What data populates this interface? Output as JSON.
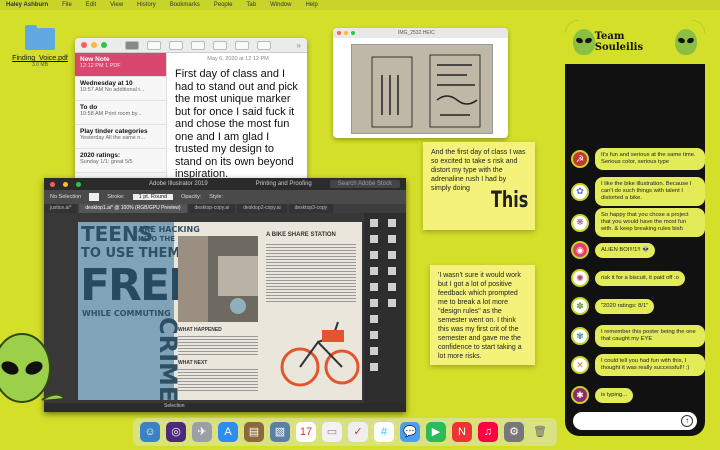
{
  "menubar": {
    "app": "Haley Ashburn",
    "items": [
      "File",
      "Edit",
      "View",
      "History",
      "Bookmarks",
      "People",
      "Tab",
      "Window",
      "Help"
    ]
  },
  "desktop": {
    "file_name": "Finding_Voice.pdf",
    "file_sub": "3.0 MB"
  },
  "notes": {
    "list": [
      {
        "title": "New Note",
        "time": "12:12 PM",
        "preview": "1 PDF"
      },
      {
        "title": "Wednesday at 10",
        "time": "10:57 AM",
        "preview": "No additional t..."
      },
      {
        "title": "To do",
        "time": "10:58 AM",
        "preview": "Print room by..."
      },
      {
        "title": "Play tinder categories",
        "time": "Yesterday",
        "preview": "All the same n..."
      },
      {
        "title": "2020 ratings:",
        "time": "Sunday",
        "preview": "1/1: great 5/5"
      }
    ],
    "date": "May 6, 2020 at 12:12 PM",
    "text": "First day of class and I had to stand out and pick the most unique marker but for once I said fuck it and chose the most fun one and I am glad I trusted my design to stand on its own beyond inspiration."
  },
  "preview": {
    "title": "IMG_2532.HEIC"
  },
  "illustrator": {
    "app_title": "Adobe Illustrator 2019",
    "workspace": "Printing and Proofing",
    "search_placeholder": "Search Adobe Stock",
    "selection_label": "No Selection",
    "stroke_label": "Stroke:",
    "stroke_value": "1 pt. Round",
    "opacity_label": "Opacity:",
    "style_label": "Style:",
    "tabs": [
      "justice.ai*",
      "desktop1.ai* @ 100% (RGB/GPU Preview)",
      "desktop-copy.ai",
      "desktop2-copy.ai",
      "desktop3-copy"
    ],
    "status": "Selection",
    "poster": {
      "teens": "TEENS",
      "hacking": "ARE HACKING",
      "into": "INTO THE BIKES",
      "use": "TO USE THEM FOR",
      "free": "FREE",
      "commuting": "WHILE COMMUTING",
      "crimes": "CRIMES",
      "heading1": "A BIKE SHARE STATION",
      "heading2": "WHAT HAPPENED",
      "heading3": "WHAT NEXT"
    }
  },
  "sticky1": {
    "text": "And the first day of class I was so excited to take s risk and distort my type with the adrenaline rush I had by simply doing",
    "big": "This"
  },
  "sticky2": {
    "text": "'I wasn't sure it would work but I got a lot of positive feedback which prompted me to break a lot more \"design rules\" as the semester went on. I think this was my first crit of the semester and gave me the confidence to start taking a lot more risks."
  },
  "messages": {
    "title": "Team Souleilis",
    "items": [
      {
        "text": "It's fun and serious at the same time. Serious color, serious type"
      },
      {
        "text": "I like the bike illustration. Because I can't do such things with talent I distorted a bike."
      },
      {
        "text": "So happy that you chose a project that you would have the most fun with. & keep breaking rules bish"
      },
      {
        "text": "ALIEN BOI!!!1!! 👽"
      },
      {
        "text": "risk it for a biscuit, it paid off :o"
      },
      {
        "text": "\"2020 ratings: 8/1\""
      },
      {
        "text": "I remember this poster being the one that caught my EYE"
      },
      {
        "text": "I could tell you had fun with this, I thought it was really successful!! :)"
      },
      {
        "text": "is typing..."
      }
    ]
  },
  "colors": {
    "background": "#d4df2a",
    "notes_selected": "#d9476f",
    "bubble": "#e3ec58",
    "sticky": "#f4f27a"
  }
}
